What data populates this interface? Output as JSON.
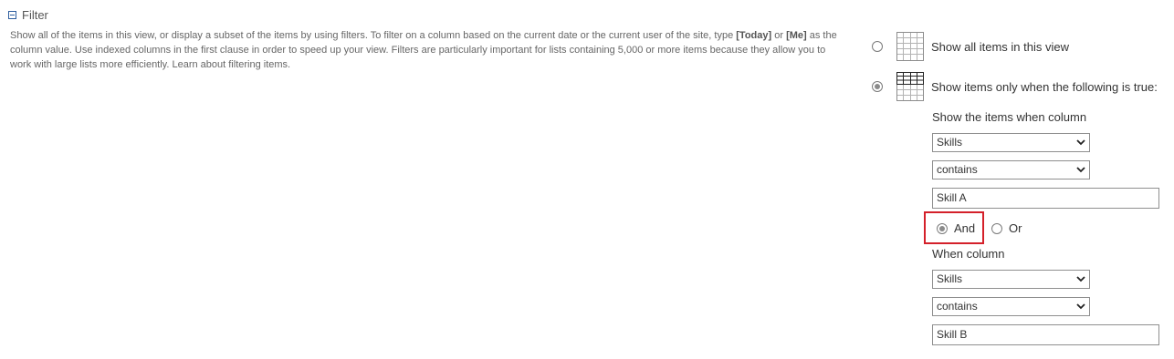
{
  "section": {
    "title": "Filter",
    "description_parts": [
      "Show all of the items in this view, or display a subset of the items by using filters. To filter on a column based on the current date or the current user of the site, type ",
      "[Today]",
      " or ",
      "[Me]",
      " as the column value. Use indexed columns in the first clause in order to speed up your view. Filters are particularly important for lists containing 5,000 or more items because they allow you to work with large lists more efficiently. Learn about filtering items."
    ]
  },
  "options": {
    "show_all": {
      "label": "Show all items in this view",
      "selected": false,
      "icon": "list-grid-icon"
    },
    "show_filtered": {
      "label": "Show items only when the following is true:",
      "selected": true,
      "icon": "list-filter-icon"
    }
  },
  "filter": {
    "first_caption": "Show the items when column",
    "first_column": "Skills",
    "first_operator": "contains",
    "first_value": "Skill A",
    "and_label": "And",
    "or_label": "Or",
    "and_selected": true,
    "second_caption": "When column",
    "second_column": "Skills",
    "second_operator": "contains",
    "second_value": "Skill B"
  },
  "colors": {
    "highlight": "#d4202a",
    "collapse_icon": "#2d5d9f"
  }
}
